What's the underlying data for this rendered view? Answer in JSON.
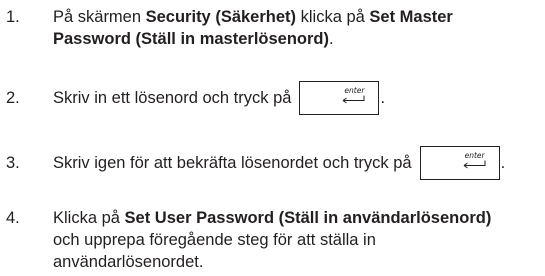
{
  "steps": [
    {
      "number": "1.",
      "parts": [
        "På skärmen ",
        "Security (Säkerhet)",
        " klicka på ",
        "Set Master",
        "Password (Ställ in masterlösenord)",
        "."
      ]
    },
    {
      "number": "2.",
      "text": "Skriv in ett lösenord och tryck på",
      "period": "."
    },
    {
      "number": "3.",
      "text": "Skriv igen för att bekräfta lösenordet och tryck på",
      "period": "."
    },
    {
      "number": "4.",
      "parts": [
        "Klicka på ",
        "Set User Password (Ställ in användarlösenord)",
        "och upprepa föregående steg för att ställa in",
        "användarlösenordet."
      ]
    }
  ],
  "enter_key": {
    "label": "enter",
    "icon": "enter-return-arrow-icon"
  }
}
